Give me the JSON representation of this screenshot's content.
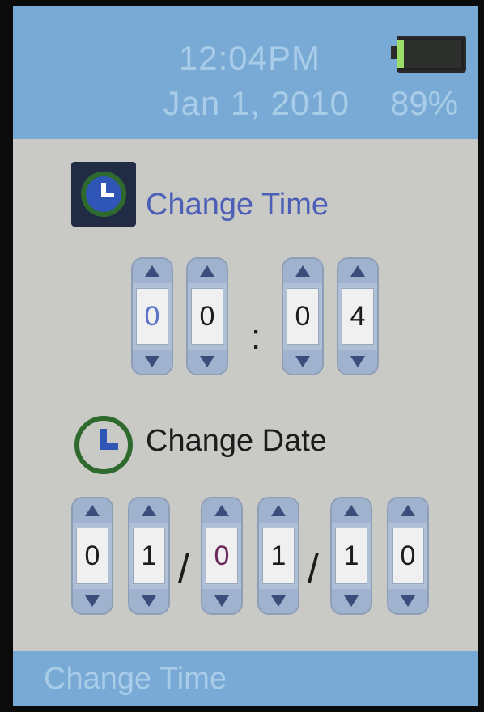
{
  "status": {
    "time": "12:04PM",
    "date": "Jan 1, 2010",
    "battery_percent": "89%",
    "battery_level": 0.89
  },
  "time_section": {
    "label": "Change Time",
    "digits": [
      "0",
      "0",
      "0",
      "4"
    ],
    "separator": ":"
  },
  "date_section": {
    "label": "Change Date",
    "digits": [
      "0",
      "1",
      "0",
      "1",
      "1",
      "0"
    ],
    "separator": "/"
  },
  "footer": {
    "title": "Change Time"
  },
  "colors": {
    "header_bg": "#79aad6",
    "screen_bg": "#c9cac6",
    "accent_text": "#4c5eb6",
    "icon_ring": "#2e6a2e",
    "icon_fill": "#2f56b6"
  },
  "icons": {
    "time_icon": "clock-icon",
    "date_icon": "clock-icon",
    "battery_icon": "battery-icon",
    "increment": "arrow-up-icon",
    "decrement": "arrow-down-icon"
  }
}
